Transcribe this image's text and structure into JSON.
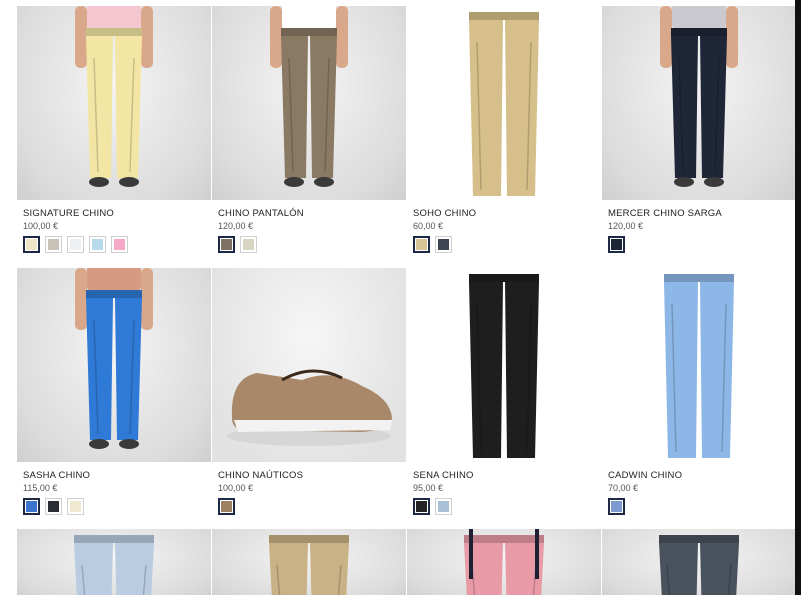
{
  "products": [
    {
      "name": "SIGNATURE CHINO",
      "price": "100,00 €",
      "swatches": [
        "#efe6c8",
        "#c8c3b6",
        "#eef0f2",
        "#b8dbeb",
        "#f6a8c8"
      ],
      "selected": 0,
      "image": "model-yellow-chino",
      "pant_color": "#f3e6a4"
    },
    {
      "name": "CHINO PANTALÓN",
      "price": "120,00 €",
      "swatches": [
        "#7d7264",
        "#d8d4c2"
      ],
      "selected": 0,
      "image": "model-taupe-chino",
      "pant_color": "#8a7a64"
    },
    {
      "name": "SOHO CHINO",
      "price": "60,00 €",
      "swatches": [
        "#d8c494",
        "#3e4450"
      ],
      "selected": 0,
      "image": "khaki-chino",
      "pant_color": "#d6bf8a"
    },
    {
      "name": "MERCER CHINO SARGA",
      "price": "120,00 €",
      "swatches": [
        "#1c2536"
      ],
      "selected": 0,
      "image": "model-navy-chino",
      "pant_color": "#1e2638"
    },
    {
      "name": "SASHA CHINO",
      "price": "115,00 €",
      "swatches": [
        "#3a74cc",
        "#2a2d34",
        "#f1e8d2"
      ],
      "selected": 0,
      "image": "model-blue-chino",
      "pant_color": "#2f7ad6"
    },
    {
      "name": "CHINO NAÚTICOS",
      "price": "100,00 €",
      "swatches": [
        "#9d7f61"
      ],
      "selected": 0,
      "image": "boat-shoe",
      "pant_color": "#a88868"
    },
    {
      "name": "SENA CHINO",
      "price": "95,00 €",
      "swatches": [
        "#232323",
        "#a9bfd6"
      ],
      "selected": 0,
      "image": "black-chino",
      "pant_color": "#1e1e1e"
    },
    {
      "name": "CADWIN CHINO",
      "price": "70,00 €",
      "swatches": [
        "#7d9ad0"
      ],
      "selected": 0,
      "image": "light-blue-chino",
      "pant_color": "#8db7e6"
    }
  ],
  "partial_products": [
    {
      "image": "light-blue-shorts",
      "color": "#b9cce0"
    },
    {
      "image": "khaki-shorts",
      "color": "#c9b285"
    },
    {
      "image": "pink-shorts-suspenders",
      "color": "#e89aa6"
    },
    {
      "image": "grey-shorts",
      "color": "#4a525e"
    }
  ]
}
